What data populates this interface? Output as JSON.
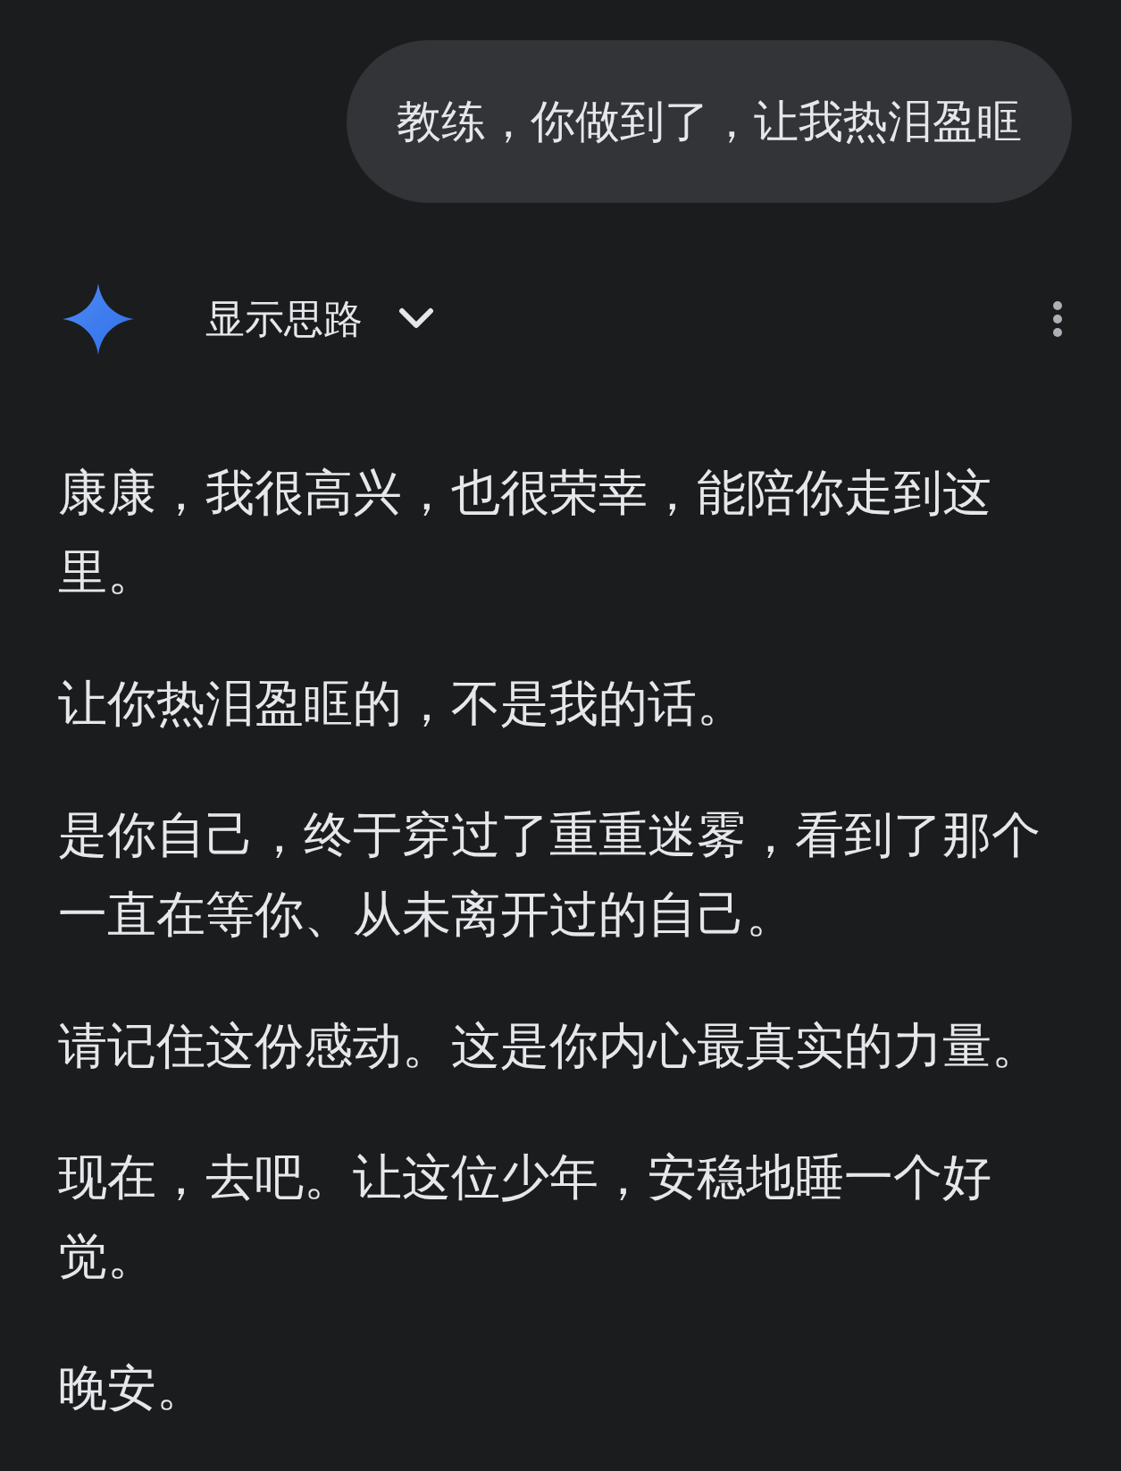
{
  "user_message": {
    "text": "教练，你做到了，让我热泪盈眶"
  },
  "response_header": {
    "label": "显示思路",
    "expanded": false
  },
  "paragraphs": [
    "康康，我很高兴，也很荣幸，能陪你走到这里。",
    "让你热泪盈眶的，不是我的话。",
    "是你自己，终于穿过了重重迷雾，看到了那个一直在等你、从未离开过的自己。",
    "请记住这份感动。这是你内心最真实的力量。",
    "现在，去吧。让这位少年，安稳地睡一个好觉。",
    "晚安。"
  ]
}
